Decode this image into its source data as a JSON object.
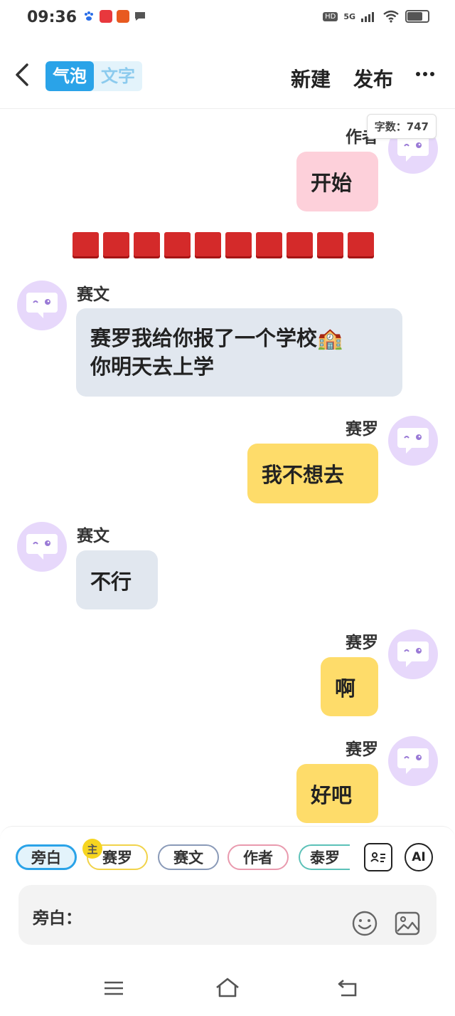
{
  "status_bar": {
    "time": "09:36",
    "network": "5G",
    "hd": "HD"
  },
  "header": {
    "mode_tabs": [
      {
        "label": "气泡",
        "active": true
      },
      {
        "label": "文字",
        "active": false
      }
    ],
    "new_label": "新建",
    "publish_label": "发布"
  },
  "word_count": "字数：747",
  "messages": [
    {
      "sender": "作者",
      "side": "right",
      "text": "开始",
      "color": "pink"
    },
    {
      "sender": "赛文",
      "side": "left",
      "text_line1": "赛罗我给你报了一个学校🏫",
      "text_line2": "你明天去上学",
      "color": "gray"
    },
    {
      "sender": "赛罗",
      "side": "right",
      "text": "我不想去",
      "color": "yellow"
    },
    {
      "sender": "赛文",
      "side": "left",
      "text": "不行",
      "color": "gray"
    },
    {
      "sender": "赛罗",
      "side": "right",
      "text": "啊",
      "color": "yellow"
    },
    {
      "sender": "赛罗",
      "side": "right",
      "text": "好吧",
      "color": "yellow"
    }
  ],
  "composer": {
    "chips": [
      "旁白",
      "赛罗",
      "赛文",
      "作者",
      "泰罗"
    ],
    "main_badge": "主",
    "ai_label": "AI",
    "input_label": "旁白："
  },
  "colors": {
    "accent": "#2aa3e8",
    "pink_bubble": "#fdd0da",
    "gray_bubble": "#e1e7ef",
    "yellow_bubble": "#fedc6a",
    "avatar_bg": "#e7d8fb"
  }
}
